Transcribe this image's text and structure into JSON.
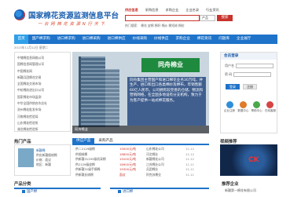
{
  "header": {
    "site_title": "国家棉花资源监测信息平台",
    "slogan": "一 云 网 棉 花 资 源 N 行 天 下",
    "tabs": [
      "供应信息",
      "采购信息",
      "求购企业",
      "企业名录",
      "行业资讯"
    ],
    "search_placeholder": "",
    "search_scope": "产品",
    "search_button": "搜索",
    "hot_keywords": "热门搜索：  棉花  皮棉  棉籽  棉纱  棉短绒  棉纺"
  },
  "nav": {
    "items": [
      "首页",
      "国产棉求购",
      "进口棉求购",
      "进口棉采购",
      "进口棉供应",
      "纱线采购",
      "纱线供应",
      "求购企业",
      "棉花资讯",
      "问题库",
      "企业展厅"
    ]
  },
  "date_strip": "2013年11月12日  星期二",
  "left_list": {
    "items": [
      "中储棉信息网络公司",
      "国棉信息网管理公司",
      "中国棉花网",
      "新疆兵团棉花交易",
      "全国棉花交易市场",
      "中纺棉纺进出口公司",
      "国家棉花市场监测",
      "中华全国供销合作总社",
      "沧州棉花批发市场",
      "河南棉花检验局",
      "山东棉花检验所",
      "湖北棉花检验所"
    ]
  },
  "banner": {
    "logo_text": "同舟棉业",
    "description": "同舟集团主营国产和进口棉花业务30万吨，并生产、进口和出口各类棉纱及棉布，年销售额60亿人民币。公司拥有较完善的仓储、物流和营销网络，在全国多地设有分支机构，致力于为客户提供一站式棉花服务。",
    "caption": "同舟棉业"
  },
  "login": {
    "title": "会员登录",
    "username_label": "用户名",
    "password_label": "密  码",
    "login_button": "登录",
    "register_button": "注册",
    "icons": [
      {
        "name": "企业注册",
        "color": "#2f8fd8"
      },
      {
        "name": "数据中心",
        "color": "#e07b2a"
      },
      {
        "name": "帮助中心",
        "color": "#4aa84a"
      },
      {
        "name": "在线客服",
        "color": "#d64545"
      }
    ]
  },
  "hot_products": {
    "title": "热门产品",
    "item": {
      "name": "新疆棉",
      "line1": "供应新疆细绒棉",
      "line2": "价格：面议",
      "line3": "地区：新疆"
    }
  },
  "supply": {
    "tabs": [
      "供应产品",
      "采购产品"
    ],
    "active_tab": 0,
    "rows": [
      {
        "title": "供二2129级棉",
        "price": "19000元/吨",
        "company": "山东棉花公司",
        "date": "11-12"
      },
      {
        "title": "供细绒棉",
        "price": "18800元/吨",
        "company": "河北棉业",
        "date": "11-12"
      },
      {
        "title": "供新疆31293级机采棉",
        "price": "19200元/吨",
        "company": "新疆棉花公司",
        "date": "11-12"
      },
      {
        "title": "供2129级皮棉",
        "price": "18900元/吨",
        "company": "江苏棉业公司",
        "date": "11-11"
      },
      {
        "title": "供新疆31级手摘棉",
        "price": "19300元/吨",
        "company": "兵团棉业",
        "date": "11-11"
      },
      {
        "title": "供新疆长绒棉",
        "price": "面议",
        "company": "阿克苏棉业",
        "date": "11-11"
      },
      {
        "title": "供棉籽",
        "price": "面议",
        "company": "河南棉业",
        "date": "11-10"
      },
      {
        "title": "供进口巴西棉",
        "price": "面议",
        "company": "青岛进出口",
        "date": "11-10"
      }
    ]
  },
  "video": {
    "title": "视频推荐",
    "overlay_text": "CK",
    "caption": "棉花资源监测宣传片"
  },
  "bottom": {
    "title_left": "产品分类",
    "title_right": "推荐企业",
    "bar1": "国产棉",
    "bar2": "进口棉",
    "bar3": "新疆第一棉花有限公司"
  }
}
